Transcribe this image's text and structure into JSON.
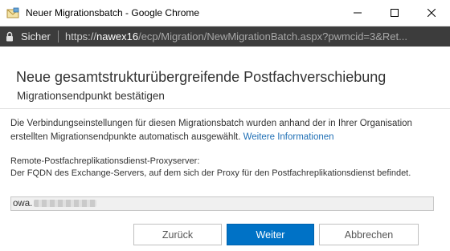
{
  "window": {
    "title": "Neuer Migrationsbatch - Google Chrome",
    "icon": "mail-icon"
  },
  "addressbar": {
    "secure_label": "Sicher",
    "url_scheme": "https://",
    "url_host": "nawex16",
    "url_path": "/ecp/Migration/NewMigrationBatch.aspx?pwmcid=3&Ret..."
  },
  "wizard": {
    "title": "Neue gesamtstrukturübergreifende Postfachverschiebung",
    "subtitle": "Migrationsendpunkt bestätigen",
    "intro_text": "Die Verbindungseinstellungen für diesen Migrationsbatch wurden anhand der in Ihrer Organisation erstellten Migrationsendpunkte automatisch ausgewählt. ",
    "intro_link": "Weitere Informationen",
    "proxy_label_line1": "Remote-Postfachreplikationsdienst-Proxyserver:",
    "proxy_label_line2": "Der FQDN des Exchange-Servers, auf dem sich der Proxy für den Postfachreplikationsdienst befindet.",
    "proxy_value": "owa."
  },
  "buttons": {
    "back": "Zurück",
    "next": "Weiter",
    "cancel": "Abbrechen"
  },
  "colors": {
    "primary": "#0072c6",
    "link": "#1f6fb5",
    "addressbar_bg": "#3c3c3c"
  }
}
